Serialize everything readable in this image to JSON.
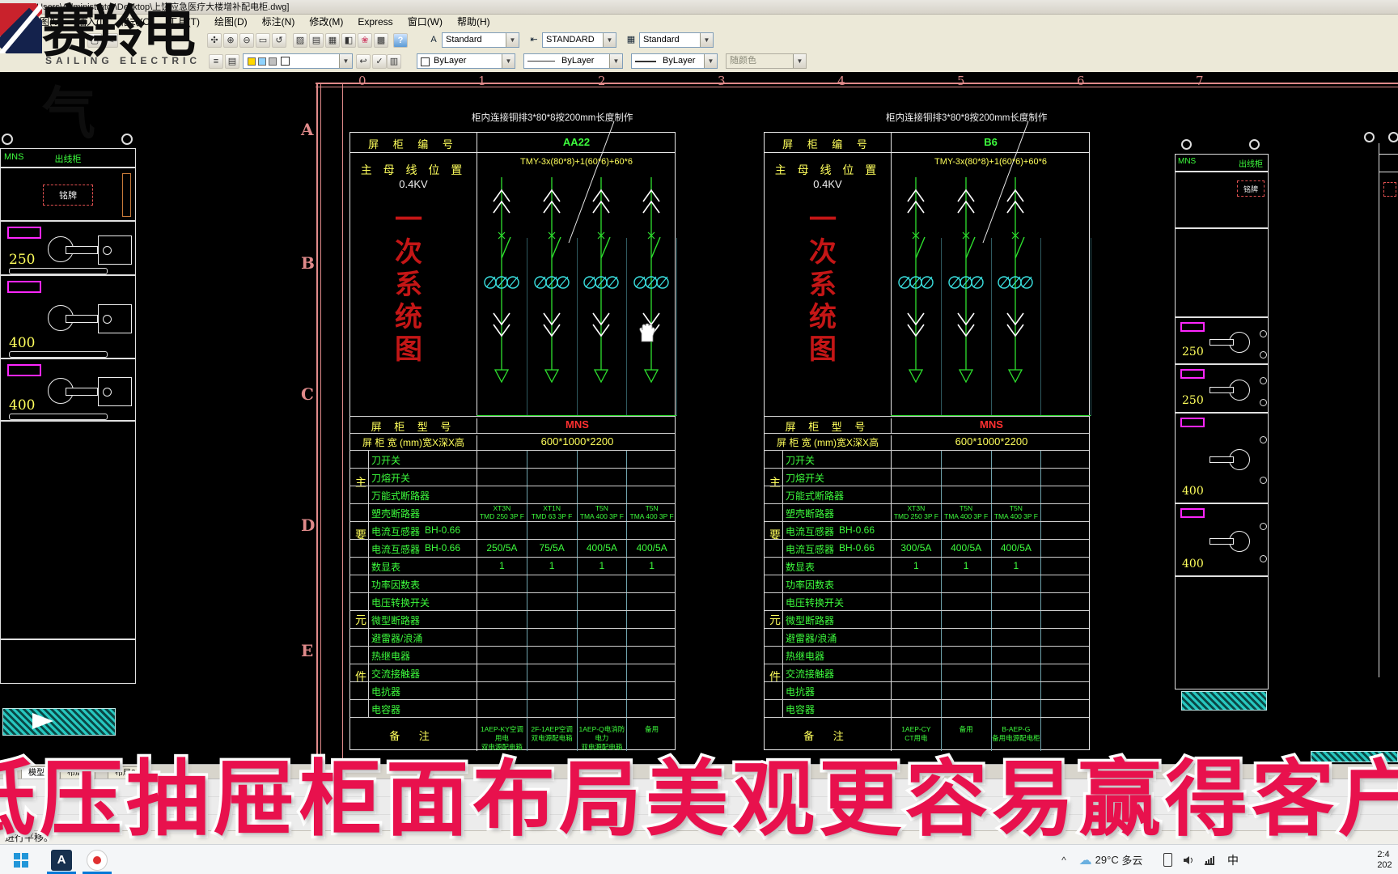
{
  "window": {
    "title": "07 - [C:\\Users\\Administrator\\Desktop\\上饶应急医疗大楼增补配电柜.dwg]"
  },
  "menu": {
    "items": [
      "视图(V)",
      "插入(I)",
      "格式(O)",
      "工具(T)",
      "绘图(D)",
      "标注(N)",
      "修改(M)",
      "Express",
      "窗口(W)",
      "帮助(H)"
    ]
  },
  "logo": {
    "cn": "赛羚电气",
    "en": "SAILING ELECTRIC"
  },
  "toolbars": {
    "row1_icons": [
      "sheet-icon",
      "markup-icon",
      "pan-hand-icon",
      "zoom-in-icon",
      "zoom-out-icon",
      "zoom-window-icon",
      "zoom-previous-icon",
      "match-properties-icon",
      "tool-palette-icon",
      "design-center-icon",
      "properties-icon",
      "markup-set-icon",
      "calculator-icon",
      "help-icon"
    ],
    "row2_icons": [
      "layer-properties-icon",
      "layer-states-icon",
      "layer-prev-icon",
      "make-current-icon",
      "layer-walk-icon"
    ],
    "text_style_label": "Standard",
    "dim_style_label": "STANDARD",
    "table_style_label": "Standard",
    "color_value": "ByLayer",
    "linetype_value": "ByLayer",
    "lineweight_value": "ByLayer",
    "plot_style_value": "随颜色"
  },
  "ruler": {
    "columns": [
      "0",
      "1",
      "2",
      "3",
      "4",
      "5",
      "6",
      "7"
    ],
    "rows": [
      "A",
      "B",
      "C",
      "D",
      "E"
    ]
  },
  "colors": {
    "cad_green": "#3dfc3d",
    "cad_yellow": "#ffff5c",
    "cad_red": "#ff3030",
    "cad_magenta": "#ff26ff",
    "cad_cyan": "#3ae0e0",
    "frame_pink": "#e08a8a",
    "banner_red": "#e8114d",
    "title_red": "#c41616"
  },
  "cabinet_left": {
    "type": "MNS",
    "title": "出线柜",
    "nameplate": "铭牌",
    "drawers": [
      "250",
      "400",
      "400"
    ]
  },
  "cabinet_right": {
    "type": "MNS",
    "title": "出线柜",
    "nameplate": "铭牌",
    "drawers": [
      "250",
      "250",
      "400",
      "400"
    ]
  },
  "panels": [
    {
      "annotation": "柜内连接铜排3*80*8按200mm长度制作",
      "no_label": "屏 柜 编 号",
      "no": "AA22",
      "bus_label": "主 母 线 位 置",
      "bus_voltage": "0.4KV",
      "busbar": "TMY-3x(80*8)+1(60*6)+60*6",
      "side_title": "一次系统图",
      "model_label": "屏 柜 型 号",
      "model": "MNS",
      "size_label": "屏 柜 宽 (mm)宽X深X高",
      "size": "600*1000*2200",
      "group_label": "主要元件",
      "feeders": 4,
      "rows": [
        {
          "label": "刀开关",
          "values": [
            "",
            "",
            "",
            ""
          ]
        },
        {
          "label": "刀熔开关",
          "values": [
            "",
            "",
            "",
            ""
          ]
        },
        {
          "label": "万能式断路器",
          "values": [
            "",
            "",
            "",
            ""
          ]
        },
        {
          "label": "塑壳断路器",
          "values": [
            "XT3N\nTMD 250 3P F",
            "XT1N\nTMD 63 3P F",
            "T5N\nTMA 400 3P F",
            "T5N\nTMA 400 3P F"
          ]
        },
        {
          "label": "电流互感器",
          "spec": "BH-0.66",
          "values": [
            "",
            "",
            "",
            ""
          ]
        },
        {
          "label": "电流互感器",
          "spec": "BH-0.66",
          "values": [
            "250/5A",
            "75/5A",
            "400/5A",
            "400/5A"
          ]
        },
        {
          "label": "数显表",
          "values": [
            "1",
            "1",
            "1",
            "1"
          ]
        },
        {
          "label": "功率因数表",
          "values": [
            "",
            "",
            "",
            ""
          ]
        },
        {
          "label": "电压转换开关",
          "values": [
            "",
            "",
            "",
            ""
          ]
        },
        {
          "label": "微型断路器",
          "values": [
            "",
            "",
            "",
            ""
          ]
        },
        {
          "label": "避雷器/浪涌",
          "values": [
            "",
            "",
            "",
            ""
          ]
        },
        {
          "label": "热继电器",
          "values": [
            "",
            "",
            "",
            ""
          ]
        },
        {
          "label": "交流接触器",
          "values": [
            "",
            "",
            "",
            ""
          ]
        },
        {
          "label": "电抗器",
          "values": [
            "",
            "",
            "",
            ""
          ]
        },
        {
          "label": "电容器",
          "values": [
            "",
            "",
            "",
            ""
          ]
        }
      ],
      "note_label": "备 注",
      "notes": [
        "1AEP-KY空调用电\n双电源配电箱",
        "2F-1AEP空调\n双电源配电箱",
        "1AEP-Q电消防电力\n双电源配电箱",
        "备用"
      ]
    },
    {
      "annotation": "柜内连接铜排3*80*8按200mm长度制作",
      "no_label": "屏 柜 编 号",
      "no": "B6",
      "bus_label": "主 母 线 位 置",
      "bus_voltage": "0.4KV",
      "busbar": "TMY-3x(80*8)+1(60*6)+60*6",
      "side_title": "一次系统图",
      "model_label": "屏 柜 型 号",
      "model": "MNS",
      "size_label": "屏 柜 宽 (mm)宽X深X高",
      "size": "600*1000*2200",
      "group_label": "主要元件",
      "feeders": 3,
      "rows": [
        {
          "label": "刀开关",
          "values": [
            "",
            "",
            "",
            ""
          ]
        },
        {
          "label": "刀熔开关",
          "values": [
            "",
            "",
            "",
            ""
          ]
        },
        {
          "label": "万能式断路器",
          "values": [
            "",
            "",
            "",
            ""
          ]
        },
        {
          "label": "塑壳断路器",
          "values": [
            "XT3N\nTMD 250 3P F",
            "T5N\nTMA 400 3P F",
            "T5N\nTMA 400 3P F",
            ""
          ]
        },
        {
          "label": "电流互感器",
          "spec": "BH-0.66",
          "values": [
            "",
            "",
            "",
            ""
          ]
        },
        {
          "label": "电流互感器",
          "spec": "BH-0.66",
          "values": [
            "300/5A",
            "400/5A",
            "400/5A",
            ""
          ]
        },
        {
          "label": "数显表",
          "values": [
            "1",
            "1",
            "1",
            ""
          ]
        },
        {
          "label": "功率因数表",
          "values": [
            "",
            "",
            "",
            ""
          ]
        },
        {
          "label": "电压转换开关",
          "values": [
            "",
            "",
            "",
            ""
          ]
        },
        {
          "label": "微型断路器",
          "values": [
            "",
            "",
            "",
            ""
          ]
        },
        {
          "label": "避雷器/浪涌",
          "values": [
            "",
            "",
            "",
            ""
          ]
        },
        {
          "label": "热继电器",
          "values": [
            "",
            "",
            "",
            ""
          ]
        },
        {
          "label": "交流接触器",
          "values": [
            "",
            "",
            "",
            ""
          ]
        },
        {
          "label": "电抗器",
          "values": [
            "",
            "",
            "",
            ""
          ]
        },
        {
          "label": "电容器",
          "values": [
            "",
            "",
            "",
            ""
          ]
        }
      ],
      "note_label": "备 注",
      "notes": [
        "1AEP-CY\nCT用电",
        "备用",
        "B-AEP-G\n备用电源配电柜",
        ""
      ]
    }
  ],
  "banner": {
    "text": "低压抽屉柜面布局美观更容易赢得客户信"
  },
  "tabs": [
    "模型",
    "布局1",
    "布局2"
  ],
  "command": {
    "prompt": "进行平移。"
  },
  "taskbar": {
    "start": "start-button",
    "apps": [
      "autocad-app",
      "recorder-app"
    ],
    "tray_expand": "^",
    "weather_temp": "29°C",
    "weather_cond": "多云",
    "tray_icons": [
      "phone-icon",
      "speaker-icon",
      "network-icon"
    ],
    "ime": "中",
    "clock_time": "2:4",
    "clock_date": "202"
  }
}
